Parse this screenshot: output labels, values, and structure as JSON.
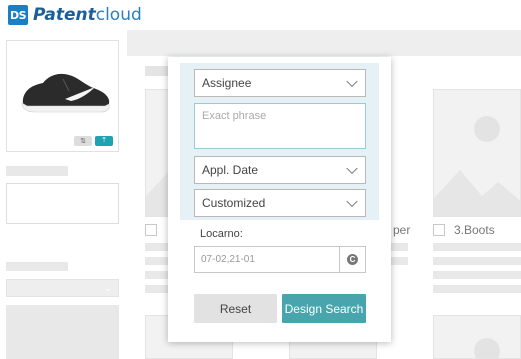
{
  "app": {
    "logo_mark": "DS",
    "logo_bold": "Patent",
    "logo_light": "cloud"
  },
  "thumbnail": {
    "crop_icon": "crop-icon",
    "upload_icon": "upload-icon"
  },
  "results": {
    "card_labels": [
      "per",
      "3.Boots"
    ]
  },
  "popup": {
    "field_assignee": "Assignee",
    "exact_phrase_placeholder": "Exact phrase",
    "field_appl_date": "Appl. Date",
    "field_customized": "Customized",
    "locarno_label": "Locarno:",
    "locarno_placeholder": "07-02,21-01",
    "reset_label": "Reset",
    "design_search_label": "Design Search"
  },
  "colors": {
    "brand": "#1a7fc4",
    "accent": "#48a5ad",
    "panel_bg": "#e6f1f6"
  }
}
